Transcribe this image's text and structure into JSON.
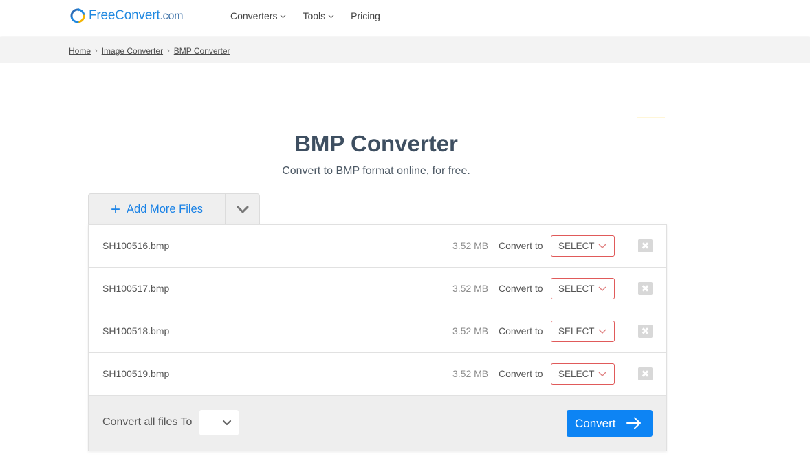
{
  "header": {
    "logo": {
      "free": "Free",
      "convert": "Convert",
      "com": ".com"
    },
    "nav": [
      {
        "label": "Converters",
        "has_dropdown": true
      },
      {
        "label": "Tools",
        "has_dropdown": true
      },
      {
        "label": "Pricing",
        "has_dropdown": false
      }
    ]
  },
  "breadcrumb": [
    "Home",
    "Image Converter",
    "BMP Converter"
  ],
  "page": {
    "title": "BMP Converter",
    "subtitle": "Convert to BMP format online, for free."
  },
  "uploader": {
    "add_more_label": "Add More Files",
    "convert_to_label": "Convert to",
    "select_label": "SELECT",
    "files": [
      {
        "name": "SH100516.bmp",
        "size": "3.52 MB"
      },
      {
        "name": "SH100517.bmp",
        "size": "3.52 MB"
      },
      {
        "name": "SH100518.bmp",
        "size": "3.52 MB"
      },
      {
        "name": "SH100519.bmp",
        "size": "3.52 MB"
      }
    ],
    "convert_all_label": "Convert all files To",
    "convert_button": "Convert"
  },
  "colors": {
    "brand_blue": "#1f88e0",
    "button_blue": "#0d84f4",
    "select_border": "#e05a5a",
    "title": "#3e4f61"
  }
}
